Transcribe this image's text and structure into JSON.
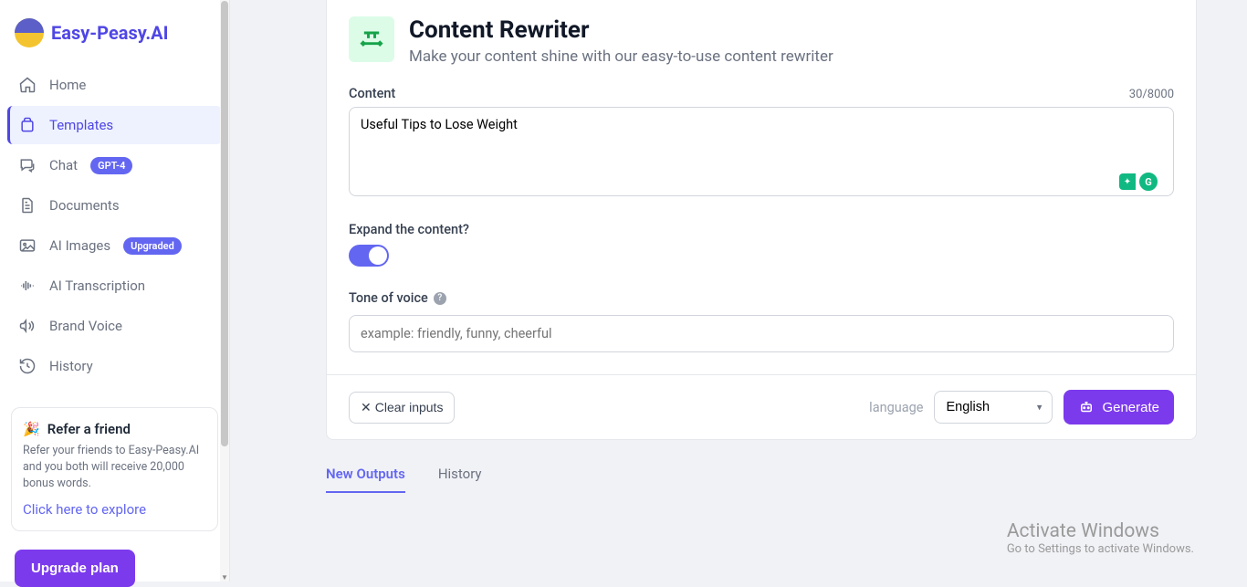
{
  "brand": "Easy-Peasy.AI",
  "sidebar": {
    "items": [
      {
        "label": "Home"
      },
      {
        "label": "Templates"
      },
      {
        "label": "Chat",
        "badge": "GPT-4"
      },
      {
        "label": "Documents"
      },
      {
        "label": "AI Images",
        "badge": "Upgraded"
      },
      {
        "label": "AI Transcription"
      },
      {
        "label": "Brand Voice"
      },
      {
        "label": "History"
      }
    ],
    "refer": {
      "title": "Refer a friend",
      "desc": "Refer your friends to Easy-Peasy.AI and you both will receive 20,000 bonus words.",
      "link": "Click here to explore"
    },
    "upgrade": "Upgrade plan"
  },
  "page": {
    "title": "Content Rewriter",
    "subtitle": "Make your content shine with our easy-to-use content rewriter"
  },
  "content": {
    "label": "Content",
    "counter": "30/8000",
    "value": "Useful Tips to Lose Weight"
  },
  "expand": {
    "label": "Expand the content?"
  },
  "tone": {
    "label": "Tone of voice",
    "placeholder": "example: friendly, funny, cheerful"
  },
  "footer": {
    "clear": "Clear inputs",
    "language_label": "language",
    "language_value": "English",
    "generate": "Generate"
  },
  "tabs": {
    "new": "New Outputs",
    "history": "History"
  },
  "watermark": {
    "title": "Activate Windows",
    "sub": "Go to Settings to activate Windows."
  }
}
